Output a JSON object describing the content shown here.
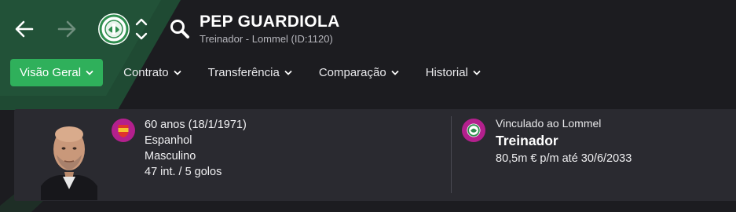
{
  "header": {
    "name": "PEP GUARDIOLA",
    "subtitle": "Treinador - Lommel (ID:1120)"
  },
  "tabs": [
    {
      "label": "Visão Geral",
      "active": true
    },
    {
      "label": "Contrato",
      "active": false
    },
    {
      "label": "Transferência",
      "active": false
    },
    {
      "label": "Comparação",
      "active": false
    },
    {
      "label": "Historial",
      "active": false
    }
  ],
  "profile": {
    "age": "60 anos (18/1/1971)",
    "nationality": "Espanhol",
    "gender": "Masculino",
    "caps": "47 int. / 5 golos"
  },
  "contract": {
    "linked": "Vinculado ao Lommel",
    "role": "Treinador",
    "wage": "80,5m € p/m até 30/6/2033"
  },
  "colors": {
    "accent": "#2fb05b",
    "background": "#1c1c20",
    "card": "#2a2a30",
    "badge": "#b3208d"
  },
  "icons": [
    "back-arrow-icon",
    "forward-arrow-icon",
    "club-crest-icon",
    "switch-club-icon",
    "search-icon",
    "chevron-down-icon",
    "spain-flag-icon",
    "club-crest-icon"
  ]
}
